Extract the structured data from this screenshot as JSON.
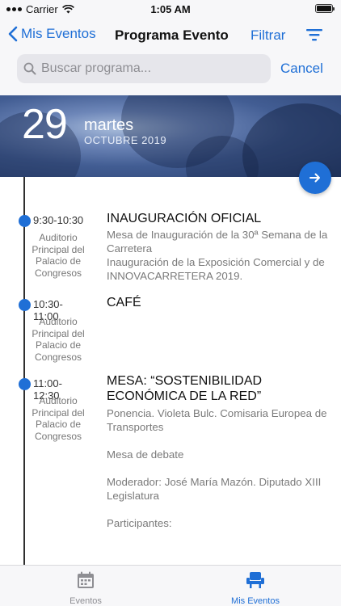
{
  "status_bar": {
    "carrier": "Carrier",
    "time": "1:05 AM"
  },
  "nav": {
    "back_label": "Mis Eventos",
    "title": "Programa Evento",
    "filter_label": "Filtrar",
    "search_placeholder": "Buscar programa...",
    "cancel_label": "Cancel"
  },
  "date_header": {
    "day": "29",
    "weekday": "martes",
    "month_year": "OCTUBRE 2019"
  },
  "colors": {
    "accent": "#1f6fd6",
    "timeline": "#2f2f2f"
  },
  "events": [
    {
      "time": "9:30-10:30",
      "place": "Auditorio Principal del Palacio de Congresos",
      "title": "INAUGURACIÓN OFICIAL",
      "description": "Mesa de Inauguración de la 30ª Semana de la Carretera\nInauguración de la Exposición Comercial y de INNOVACARRETERA 2019."
    },
    {
      "time": "10:30-11:00",
      "place": "Auditorio Principal del Palacio de Congresos",
      "title": "CAFÉ",
      "description": ""
    },
    {
      "time": "11:00-12:30",
      "place": "Auditorio Principal del Palacio de Congresos",
      "title": "MESA: “SOSTENIBILIDAD ECONÓMICA DE LA RED”",
      "description": "Ponencia. Violeta Bulc. Comisaria Europea de Transportes\n\nMesa de debate\n\n Moderador: José María Mazón. Diputado XIII Legislatura\n\nParticipantes:"
    }
  ],
  "tabs": [
    {
      "label": "Eventos",
      "icon": "calendar-icon",
      "selected": false
    },
    {
      "label": "Mis Eventos",
      "icon": "chair-icon",
      "selected": true
    }
  ]
}
